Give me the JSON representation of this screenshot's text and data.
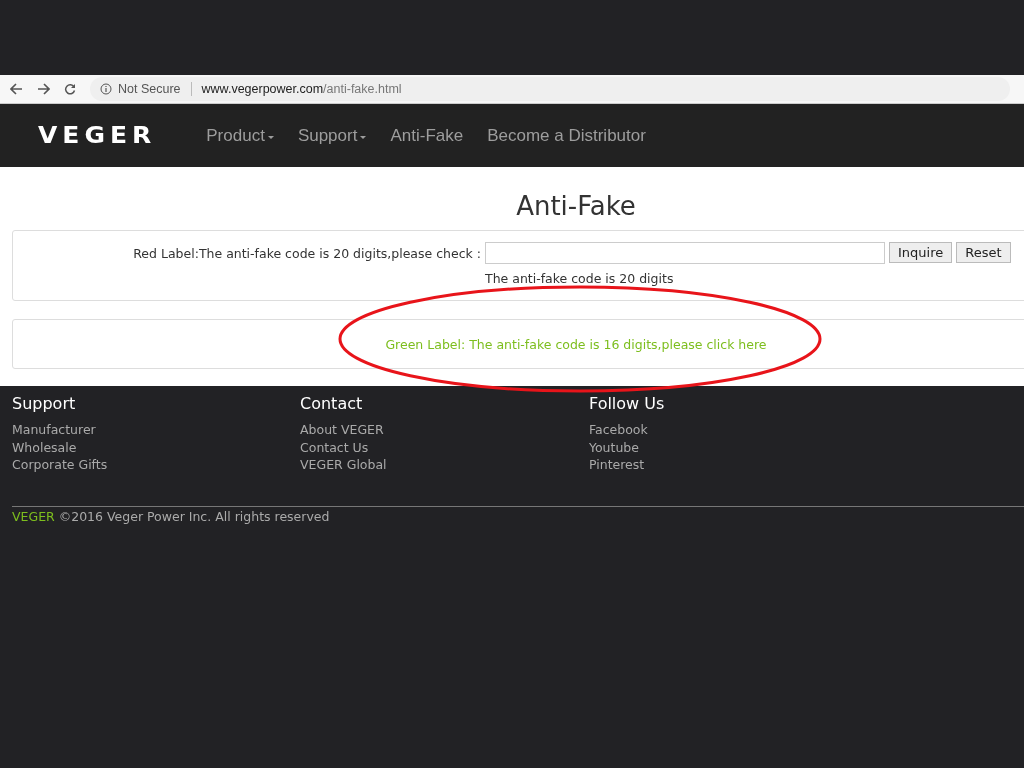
{
  "browser": {
    "security": "Not Secure",
    "url_domain": "www.vegerpower.com",
    "url_path": "/anti-fake.html"
  },
  "nav": {
    "logo": "VEGER",
    "items": [
      {
        "label": "Product",
        "dropdown": true
      },
      {
        "label": "Support",
        "dropdown": true
      },
      {
        "label": "Anti-Fake",
        "dropdown": false
      },
      {
        "label": "Become a Distributor",
        "dropdown": false
      }
    ]
  },
  "page_title": "Anti-Fake",
  "red_label": {
    "label": "Red Label:The anti-fake code is 20 digits,please check :",
    "hint": "The anti-fake code is 20 digits",
    "buttons": [
      "Inquire",
      "Reset"
    ]
  },
  "green_label": {
    "link": "Green Label: The anti-fake code is 16 digits,please click here"
  },
  "footer": {
    "columns": [
      {
        "heading": "Support",
        "links": [
          "Manufacturer",
          "Wholesale",
          "Corporate Gifts"
        ]
      },
      {
        "heading": "Contact",
        "links": [
          "About VEGER",
          "Contact Us",
          "VEGER Global"
        ]
      },
      {
        "heading": "Follow Us",
        "links": [
          "Facebook",
          "Youtube",
          "Pinterest"
        ]
      }
    ],
    "brand": "VEGER",
    "copyright": "©2016 Veger Power Inc. All rights reserved"
  }
}
